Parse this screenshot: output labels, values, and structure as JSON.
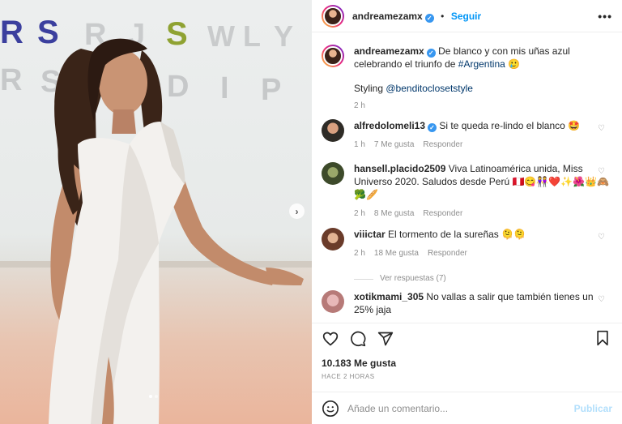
{
  "post": {
    "username": "andreamezamx",
    "follow_label": "Seguir",
    "more_label": "•••",
    "caption_text": "De blanco y con mis uñas azul celebrando el triunfo de",
    "caption_hashtag": "#Argentina",
    "caption_emoji": "🥲",
    "styling_label": "Styling",
    "styling_mention": "@benditoclosetstyle",
    "caption_time": "2 h"
  },
  "photo": {
    "wall_letters_row1": [
      "R",
      "S",
      "R",
      "J",
      "S",
      "W",
      "L",
      "Y"
    ],
    "wall_letters_row2": [
      "R",
      "S",
      "D",
      "I",
      "P"
    ],
    "next_label": "›"
  },
  "comments": [
    {
      "username": "alfredolomeli13",
      "verified": true,
      "text": "Si te queda re-lindo el blanco 🤩",
      "time": "1 h",
      "likes": "7 Me gusta",
      "reply": "Responder"
    },
    {
      "username": "hansell.placido2509",
      "verified": false,
      "text": "Viva Latinoamérica unida, Miss Universo 2020. Saludos desde Perú 🇵🇪😋👭❤️✨🌺👑🙈 🥦🥖",
      "time": "2 h",
      "likes": "8 Me gusta",
      "reply": "Responder"
    },
    {
      "username": "viiictar",
      "verified": false,
      "text": "El tormento de la sureñas 🫠🫠",
      "time": "2 h",
      "likes": "18 Me gusta",
      "reply": "Responder",
      "view_replies": "Ver respuestas (7)"
    },
    {
      "username": "xotikmami_305",
      "verified": false,
      "text": "No vallas a salir que también tienes un 25% jaja",
      "time": "",
      "likes": "",
      "reply": ""
    }
  ],
  "stats": {
    "likes": "10.183 Me gusta",
    "time_ago": "HACE 2 HORAS"
  },
  "composer": {
    "placeholder": "Añade un comentario...",
    "publish_label": "Publicar"
  },
  "colors": {
    "accent": "#0095f6",
    "verified": "#3897f0",
    "muted": "#8e8e8e"
  }
}
